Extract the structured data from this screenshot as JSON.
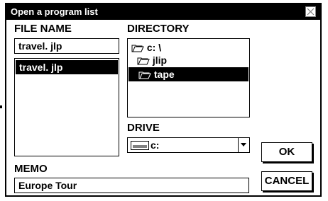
{
  "dialog": {
    "title": "Open a program list",
    "close_icon": "close-icon"
  },
  "file_name": {
    "label": "FILE NAME",
    "value": "travel. jlp",
    "list": [
      "travel. jlp"
    ],
    "selected_index": 0
  },
  "directory": {
    "label": "DIRECTORY",
    "items": [
      {
        "label": "c: \\",
        "icon": "folder-open-icon"
      },
      {
        "label": "jlip",
        "icon": "folder-open-icon"
      },
      {
        "label": "tape",
        "icon": "folder-open-icon"
      }
    ],
    "selected_index": 2
  },
  "drive": {
    "label": "DRIVE",
    "selected": "c:",
    "icon": "drive-icon"
  },
  "memo": {
    "label": "MEMO",
    "value": "Europe Tour"
  },
  "buttons": {
    "ok": "OK",
    "cancel": "CANCEL"
  }
}
